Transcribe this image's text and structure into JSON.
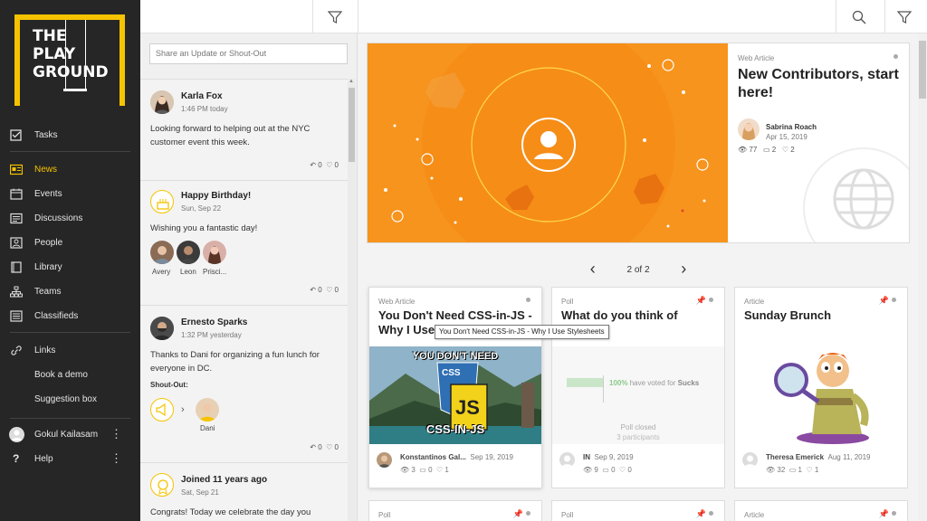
{
  "logo": {
    "line1": "THE",
    "line2": "PLAY",
    "line3": "GROUND"
  },
  "nav": {
    "tasks": "Tasks",
    "news": "News",
    "events": "Events",
    "discussions": "Discussions",
    "people": "People",
    "library": "Library",
    "teams": "Teams",
    "classifieds": "Classifieds",
    "links": "Links",
    "book_demo": "Book a demo",
    "suggestion": "Suggestion box",
    "user": "Gokul Kailasam",
    "help": "Help",
    "dots": "⋮",
    "help_icon": "?"
  },
  "colors": {
    "accent": "#f5c300",
    "sidebar": "#262626",
    "hero": "#f7941d"
  },
  "feed": {
    "placeholder": "Share an Update or Shout-Out",
    "items": [
      {
        "name": "Karla Fox",
        "date": "1:46 PM today",
        "body": "Looking forward to helping out at the NYC customer event this week.",
        "replies": "0",
        "likes": "0"
      },
      {
        "name": "Happy Birthday!",
        "date": "Sun, Sep 22",
        "body": "Wishing you a fantastic day!",
        "people": [
          "Avery",
          "Leon",
          "Prisci..."
        ],
        "replies": "0",
        "likes": "0"
      },
      {
        "name": "Ernesto Sparks",
        "date": "1:32 PM yesterday",
        "body": "Thanks to Dani for organizing a fun lunch for everyone in DC.",
        "shout_label": "Shout-Out:",
        "shout_to": "Dani",
        "replies": "0",
        "likes": "0"
      },
      {
        "name": "Joined 11 years ago",
        "date": "Sat, Sep 21",
        "body": "Congrats! Today we celebrate the day you"
      }
    ]
  },
  "hero": {
    "tag": "Web Article",
    "title": "New Contributors, start here!",
    "author": "Sabrina Roach",
    "date": "Apr 15, 2019",
    "views": "77",
    "comments": "2",
    "likes": "2"
  },
  "pager": {
    "label": "2 of 2",
    "prev": "‹",
    "next": "›"
  },
  "cards": [
    {
      "tag": "Web Article",
      "title": "You Don't Need CSS-in-JS - Why I Use Stylesheets",
      "img_top": "YOU DON'T NEED",
      "img_bottom": "CSS-IN-JS",
      "img_css": "CSS",
      "img_js": "JS",
      "author": "Konstantinos Gal...",
      "date": "Sep 19, 2019",
      "views": "3",
      "comments": "0",
      "likes": "1"
    },
    {
      "tag": "Poll",
      "title": "What do you think of Remit?",
      "poll_pct": "100%",
      "poll_text": "have voted for",
      "poll_choice": "Sucks",
      "poll_status": "Poll closed",
      "poll_participants": "3 participants",
      "poll_value": 1.0,
      "author": "IN",
      "date": "Sep 9, 2019",
      "views": "9",
      "comments": "0",
      "likes": "0"
    },
    {
      "tag": "Article",
      "title": "Sunday Brunch",
      "author": "Theresa Emerick",
      "date": "Aug 11, 2019",
      "views": "32",
      "comments": "1",
      "likes": "1"
    }
  ],
  "cards_row2": [
    {
      "tag": "Poll"
    },
    {
      "tag": "Poll"
    },
    {
      "tag": "Article"
    }
  ],
  "tooltip": "You Don't Need CSS-in-JS - Why I Use Stylesheets"
}
